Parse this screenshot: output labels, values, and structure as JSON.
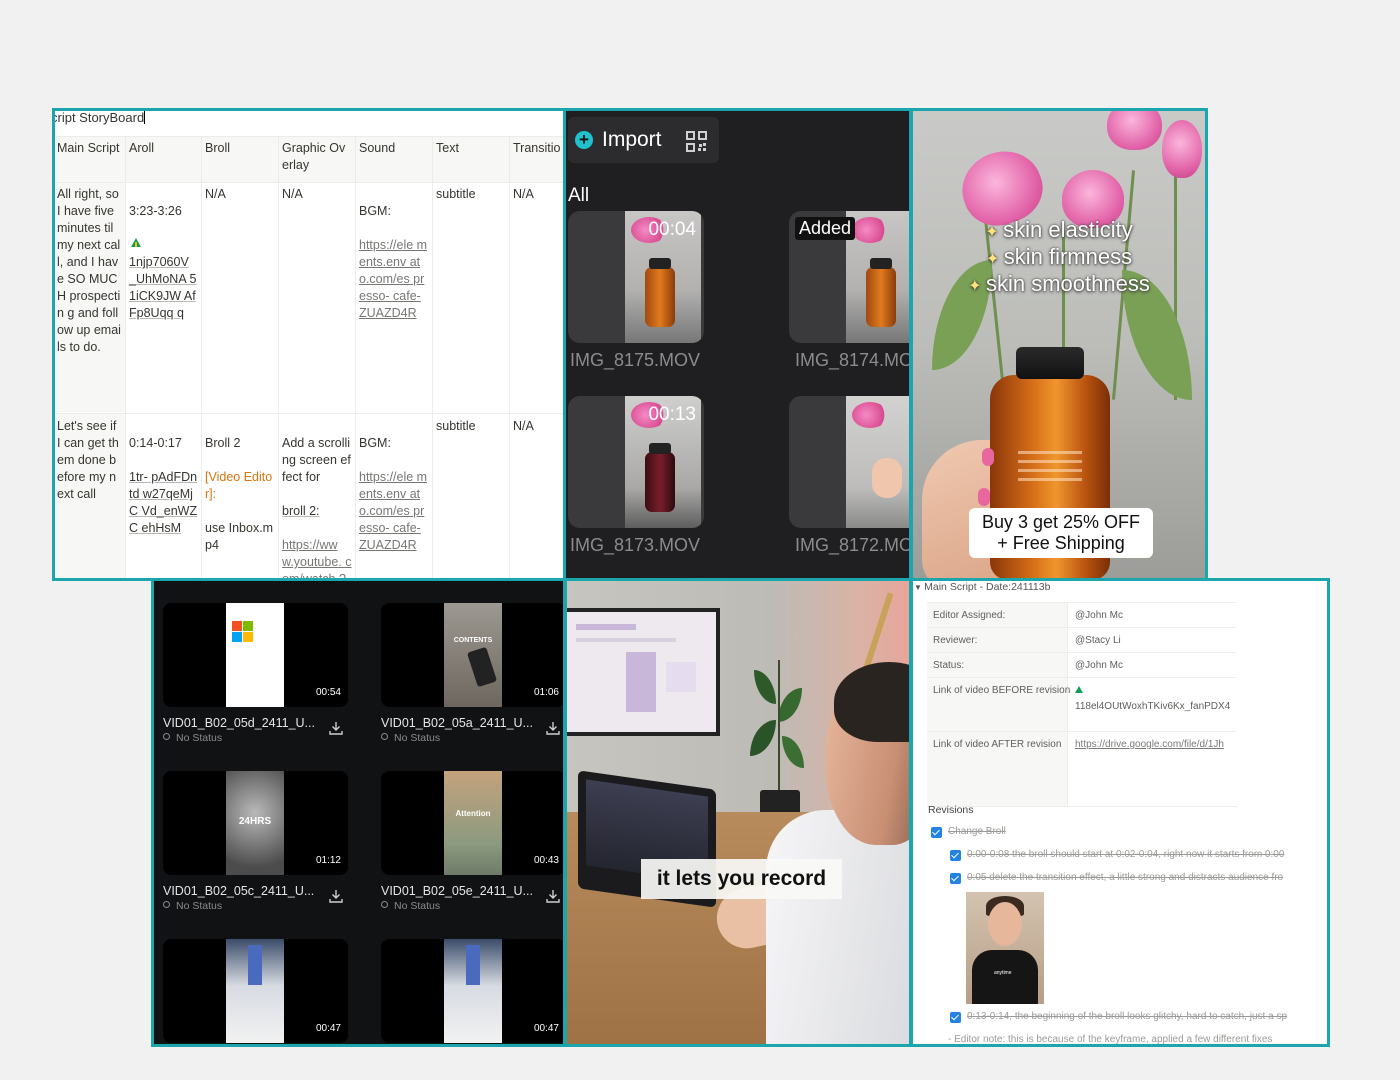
{
  "storyboard": {
    "title": "cript StoryBoard",
    "columns": [
      "Main Script",
      "Aroll",
      "Broll",
      "Graphic Overlay",
      "Sound",
      "Text",
      "Transitio"
    ],
    "rows": [
      {
        "main_script": "All right, so I have five minutes til my next call, and I have SO MUCH prospectin g and follow up emails to do.",
        "aroll": "3:23-3:26",
        "aroll_link": "1njp7060V _UhMoNA 51iCK9JW AfFp8Uqq q",
        "broll": "N/A",
        "graphic": "N/A",
        "sound_label": "BGM:",
        "sound_link": "https://ele ments.env ato.com/es presso- cafe- ZUAZD4R",
        "text": "subtitle",
        "transition": "N/A"
      },
      {
        "main_script": "Let's see if I can get them done before my next call",
        "aroll": "0:14-0:17",
        "aroll_link": "1tr- pAdFDntd w27qeMjC Vd_enWZC ehHsM",
        "broll_a": "Broll 2",
        "broll_b": "[Video Editor]:",
        "broll_c": "use Inbox.mp4",
        "graphic_a": "Add a scrolling screen effect for",
        "graphic_b": "broll 2:",
        "graphic_c": "https://ww w.youtube. com/watch ?",
        "sound_label": "BGM:",
        "sound_link": "https://ele ments.env ato.com/es presso- cafe- ZUAZD4R",
        "text": "subtitle",
        "transition": "N/A"
      }
    ]
  },
  "importer": {
    "import_label": "Import",
    "all_label": "All",
    "added_label": "Added",
    "clips": [
      {
        "duration": "00:04",
        "name": "IMG_8175.MOV"
      },
      {
        "duration": "",
        "name": "IMG_8174.MO"
      },
      {
        "duration": "00:13",
        "name": "IMG_8173.MOV"
      },
      {
        "duration": "",
        "name": "IMG_8172.MO"
      }
    ]
  },
  "ad": {
    "claim_1": "skin elasticity",
    "claim_2": "skin firmness",
    "claim_3": "skin smoothness",
    "offer_1": "Buy 3 get 25% OFF",
    "offer_2": "+ Free Shipping"
  },
  "library": {
    "videos": [
      {
        "title": "VID01_B02_05d_2411_U...",
        "status": "No Status",
        "duration": "00:54",
        "overlay": ""
      },
      {
        "title": "VID01_B02_05a_2411_U...",
        "status": "No Status",
        "duration": "01:06",
        "overlay": "CONTENTS"
      },
      {
        "title": "VID01_B02_05c_2411_U...",
        "status": "No Status",
        "duration": "01:12",
        "overlay": "24HRS"
      },
      {
        "title": "VID01_B02_05e_2411_U...",
        "status": "No Status",
        "duration": "00:43",
        "overlay": "Attention"
      },
      {
        "duration": "00:47"
      },
      {
        "duration": "00:47"
      }
    ]
  },
  "video_frame": {
    "caption": "it lets you record"
  },
  "revision_doc": {
    "section_title": "Main Script - Date:241113b",
    "fields": [
      {
        "key": "Editor Assigned:",
        "value": "@John Mc"
      },
      {
        "key": "Reviewer:",
        "value": "@Stacy Li"
      },
      {
        "key": "Status:",
        "value": "@John Mc"
      },
      {
        "key": "Link of video BEFORE revision",
        "value": "118el4OUtWoxhTKiv6Kx_fanPDX4"
      },
      {
        "key": "Link of video AFTER revision",
        "value": "https://drive.google.com/file/d/1Jh"
      }
    ],
    "revisions_title": "Revisions",
    "parent_item": "Change Broll",
    "items": [
      "0:00-0:08 the broll should start at 0:02-0:04, right now it starts from 0:00",
      "0:05 delete the transition effect, a little strong and distracts audience fro",
      "0:13-0:14, the beginning of the broll looks glitchy, hard to catch, just a sp"
    ],
    "editor_note": "- Editor note: this is because of the keyframe, applied a few different fixes"
  },
  "colors": {
    "frame_accent": "#1ba5ad",
    "import_plus": "#1fc2cc",
    "checkbox_blue": "#2383e2",
    "editor_orange": "#d9730d"
  }
}
